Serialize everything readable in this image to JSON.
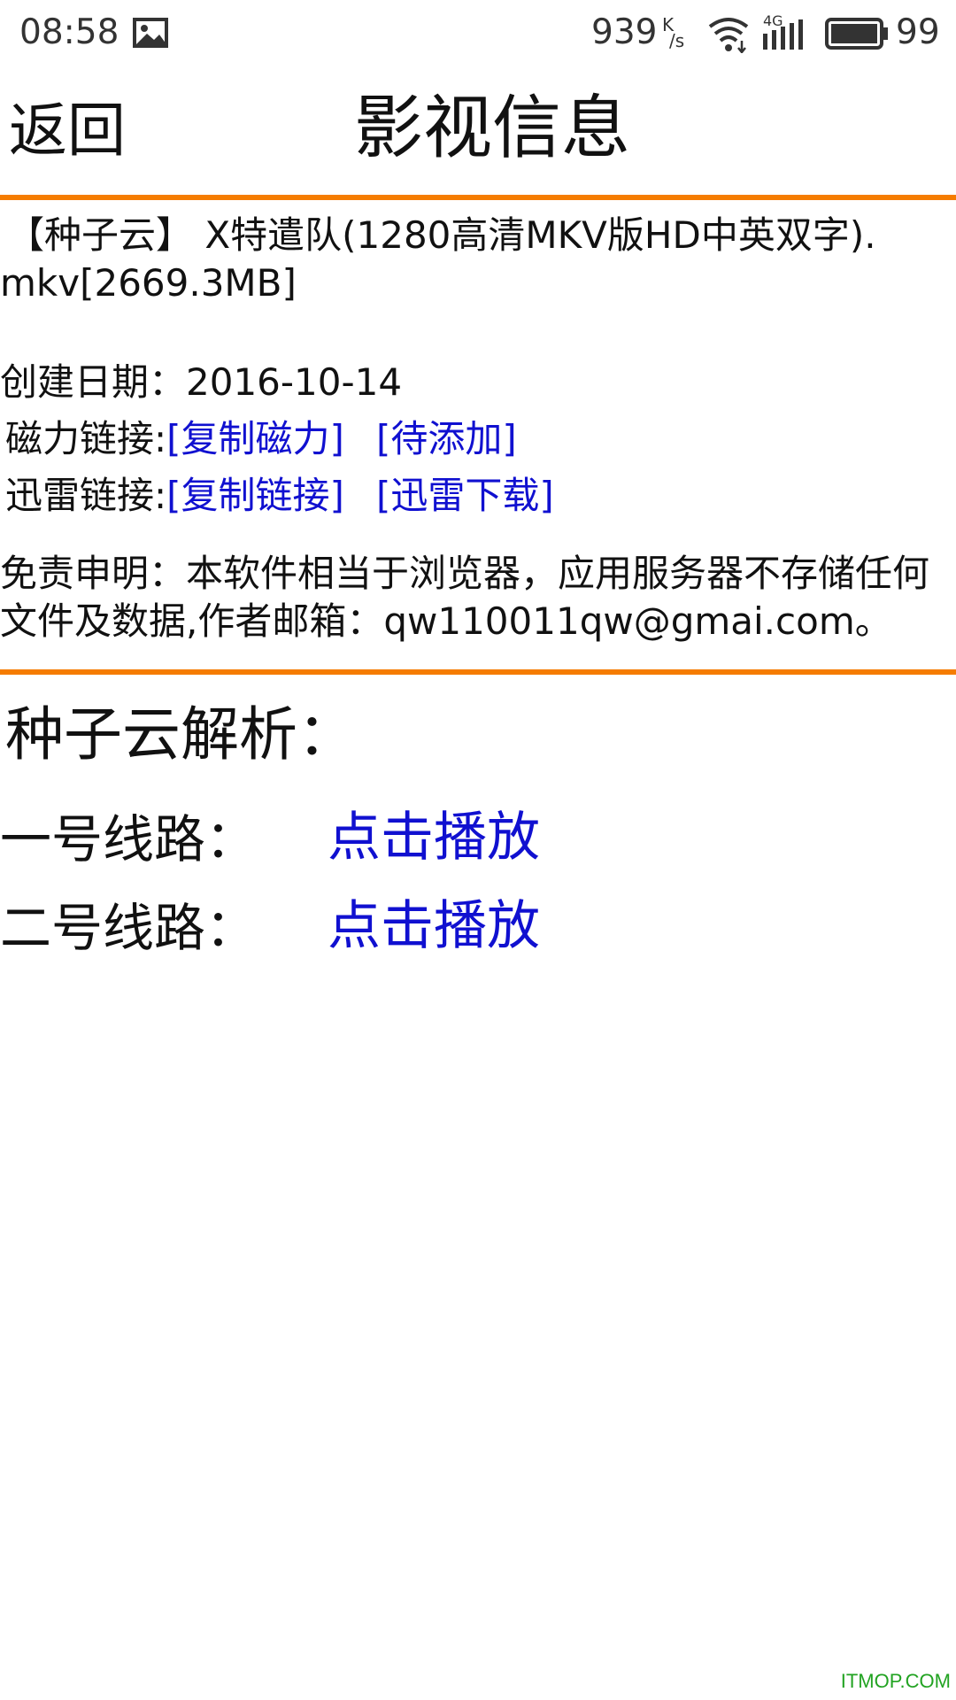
{
  "status_bar": {
    "time": "08:58",
    "gallery_icon": "image-icon",
    "net_speed": "939",
    "net_unit_top": "K",
    "net_unit_bottom": "/s",
    "network_type": "4G",
    "battery_level": "99",
    "icons": [
      "image-icon",
      "wifi-icon",
      "signal-icon",
      "battery-icon"
    ]
  },
  "header": {
    "back_label": "返回",
    "title": "影视信息"
  },
  "colors": {
    "accent": "#f57c00",
    "link": "#1010d0",
    "watermark": "#22a322"
  },
  "info": {
    "file_title_line1": "【种子云】 X特遣队(1280高清MKV版HD中英双字).",
    "file_title_line2": "mkv[2669.3MB]",
    "created_label": "创建日期：",
    "created_date": "2016-10-14",
    "magnet_label": "磁力链接:",
    "copy_magnet": "[复制磁力]",
    "pending_add": "[待添加]",
    "thunder_label": "迅雷链接:",
    "copy_link": "[复制链接]",
    "thunder_download": "[迅雷下载]",
    "disclaimer_line1": "免责申明：本软件相当于浏览器，应用服务器不存储任何",
    "disclaimer_line2": "文件及数据,作者邮箱：qw110011qw@gmai.com。"
  },
  "parse": {
    "heading": "种子云解析：",
    "routes": [
      {
        "label": "一号线路：",
        "action": "点击播放"
      },
      {
        "label": "二号线路：",
        "action": "点击播放"
      }
    ]
  },
  "watermark": "ITMOP.COM"
}
